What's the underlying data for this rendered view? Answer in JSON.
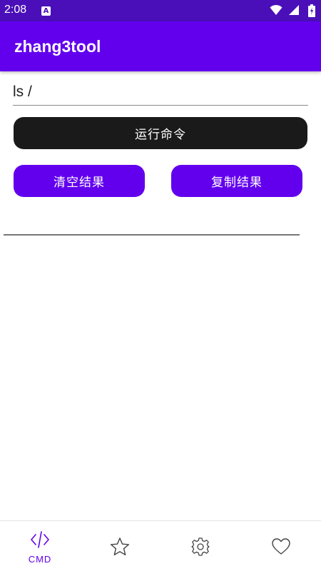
{
  "status_bar": {
    "time": "2:08",
    "app_icon_letter": "A",
    "icons": [
      "wifi-icon",
      "signal-icon",
      "battery-icon"
    ]
  },
  "app_bar": {
    "title": "zhang3tool",
    "color": "#6200ee"
  },
  "command": {
    "value": "ls /"
  },
  "buttons": {
    "run": "运行命令",
    "clear": "清空结果",
    "copy": "复制结果"
  },
  "result": {
    "text": ""
  },
  "bottom_nav": {
    "items": [
      {
        "icon": "code-icon",
        "label": "CMD",
        "active": true
      },
      {
        "icon": "star-icon",
        "label": "",
        "active": false
      },
      {
        "icon": "settings-icon",
        "label": "",
        "active": false
      },
      {
        "icon": "heart-icon",
        "label": "",
        "active": false
      }
    ]
  },
  "colors": {
    "primary": "#6200ee",
    "primary_dark": "#4a0fb8",
    "run_button": "#1a1a1a"
  }
}
